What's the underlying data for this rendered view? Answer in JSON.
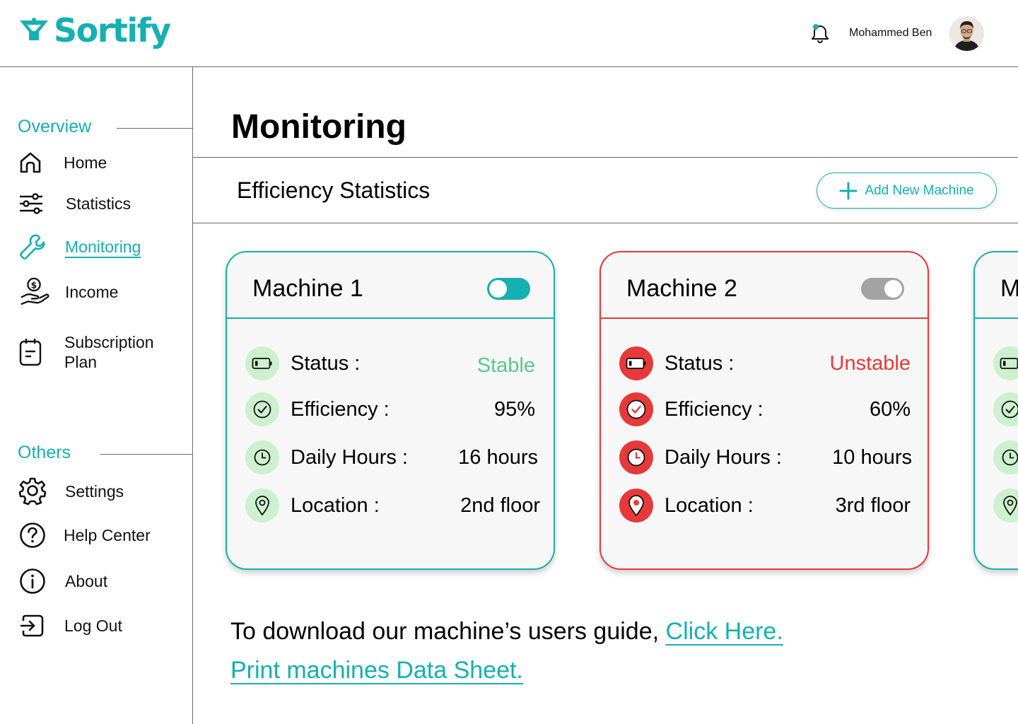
{
  "brand": {
    "name": "Sortify",
    "color": "#15b0b2"
  },
  "header": {
    "user_name": "Mohammed Ben"
  },
  "sidebar": {
    "overview_label": "Overview",
    "others_label": "Others",
    "items": [
      {
        "label": "Home",
        "icon": "home-icon"
      },
      {
        "label": "Statistics",
        "icon": "sliders-icon"
      },
      {
        "label": "Monitoring",
        "icon": "wrench-icon",
        "active": true
      },
      {
        "label": "Income",
        "icon": "income-icon"
      },
      {
        "label": "Subscription",
        "label2": "Plan",
        "icon": "clipboard-icon"
      }
    ],
    "others": [
      {
        "label": "Settings",
        "icon": "gear-icon"
      },
      {
        "label": "Help Center",
        "icon": "help-icon"
      },
      {
        "label": "About",
        "icon": "info-icon"
      },
      {
        "label": "Log Out",
        "icon": "logout-icon"
      }
    ]
  },
  "main": {
    "title": "Monitoring",
    "subtitle": "Efficiency Statistics",
    "add_button": "Add New Machine",
    "labels": {
      "status": "Status :",
      "efficiency": "Efficiency :",
      "hours": "Daily Hours :",
      "location": "Location :"
    },
    "machines": [
      {
        "name": "Machine 1",
        "enabled": true,
        "status": "Stable",
        "efficiency": "95%",
        "hours": "16 hours",
        "location": "2nd floor",
        "color": "#15b0b2"
      },
      {
        "name": "Machine 2",
        "enabled": false,
        "status": "Unstable",
        "efficiency": "60%",
        "hours": "10 hours",
        "location": "3rd floor",
        "color": "#e8393a"
      },
      {
        "name": "M"
      }
    ],
    "footer": {
      "guide_text": "To download our machine’s users guide, ",
      "guide_link": "Click Here.",
      "print_link": "Print machines Data Sheet."
    }
  },
  "colors": {
    "accent": "#15b0b2",
    "danger": "#e8393a",
    "success": "#5cc98c",
    "success_bg": "#cdf1ce"
  }
}
